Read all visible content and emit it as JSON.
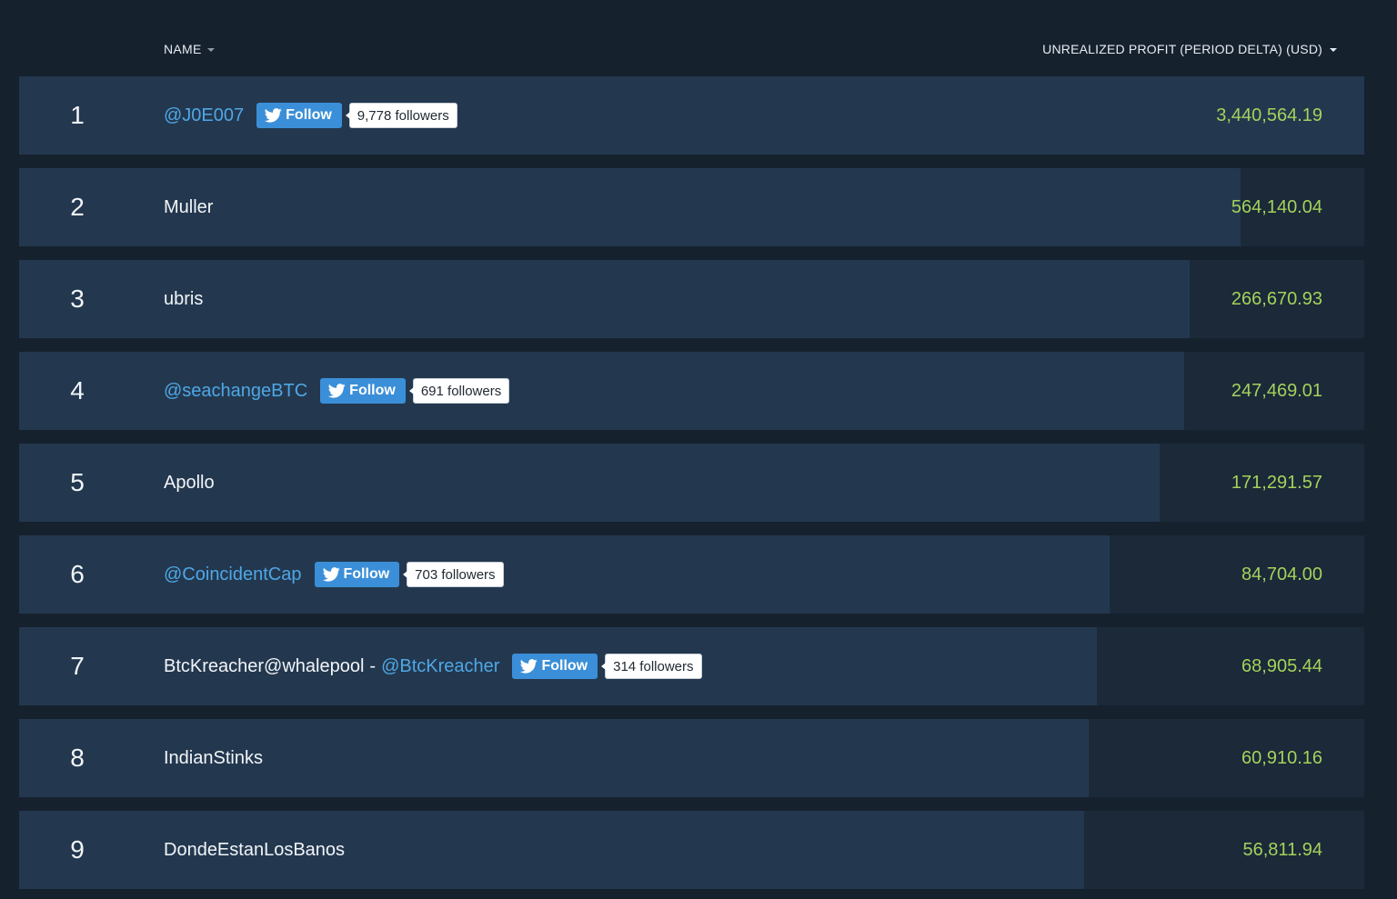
{
  "header": {
    "name_label": "NAME",
    "profit_label": "UNREALIZED PROFIT (PERIOD DELTA) (USD)"
  },
  "colors": {
    "background": "#16212e",
    "row_track": "#1b2939",
    "row_bar": "#23384f",
    "handle_link": "#4fa7e6",
    "profit_text": "#a4d25b",
    "follow_button": "#3b8fd8"
  },
  "follow_label": "Follow",
  "rows": [
    {
      "rank": "1",
      "name": "",
      "separator": "",
      "handle": "@J0E007",
      "followers": "9,778 followers",
      "profit": "3,440,564.19",
      "bar_fraction": 1.0
    },
    {
      "rank": "2",
      "name": "Muller",
      "separator": "",
      "handle": "",
      "followers": "",
      "profit": "564,140.04",
      "bar_fraction": 0.908
    },
    {
      "rank": "3",
      "name": "ubris",
      "separator": "",
      "handle": "",
      "followers": "",
      "profit": "266,670.93",
      "bar_fraction": 0.87
    },
    {
      "rank": "4",
      "name": "",
      "separator": "",
      "handle": "@seachangeBTC",
      "followers": "691 followers",
      "profit": "247,469.01",
      "bar_fraction": 0.866
    },
    {
      "rank": "5",
      "name": "Apollo",
      "separator": "",
      "handle": "",
      "followers": "",
      "profit": "171,291.57",
      "bar_fraction": 0.848
    },
    {
      "rank": "6",
      "name": "",
      "separator": "",
      "handle": "@CoincidentCap",
      "followers": "703 followers",
      "profit": "84,704.00",
      "bar_fraction": 0.811
    },
    {
      "rank": "7",
      "name": "BtcKreacher@whalepool",
      "separator": "-",
      "handle": "@BtcKreacher",
      "followers": "314 followers",
      "profit": "68,905.44",
      "bar_fraction": 0.801
    },
    {
      "rank": "8",
      "name": "IndianStinks",
      "separator": "",
      "handle": "",
      "followers": "",
      "profit": "60,910.16",
      "bar_fraction": 0.795
    },
    {
      "rank": "9",
      "name": "DondeEstanLosBanos",
      "separator": "",
      "handle": "",
      "followers": "",
      "profit": "56,811.94",
      "bar_fraction": 0.792
    }
  ]
}
